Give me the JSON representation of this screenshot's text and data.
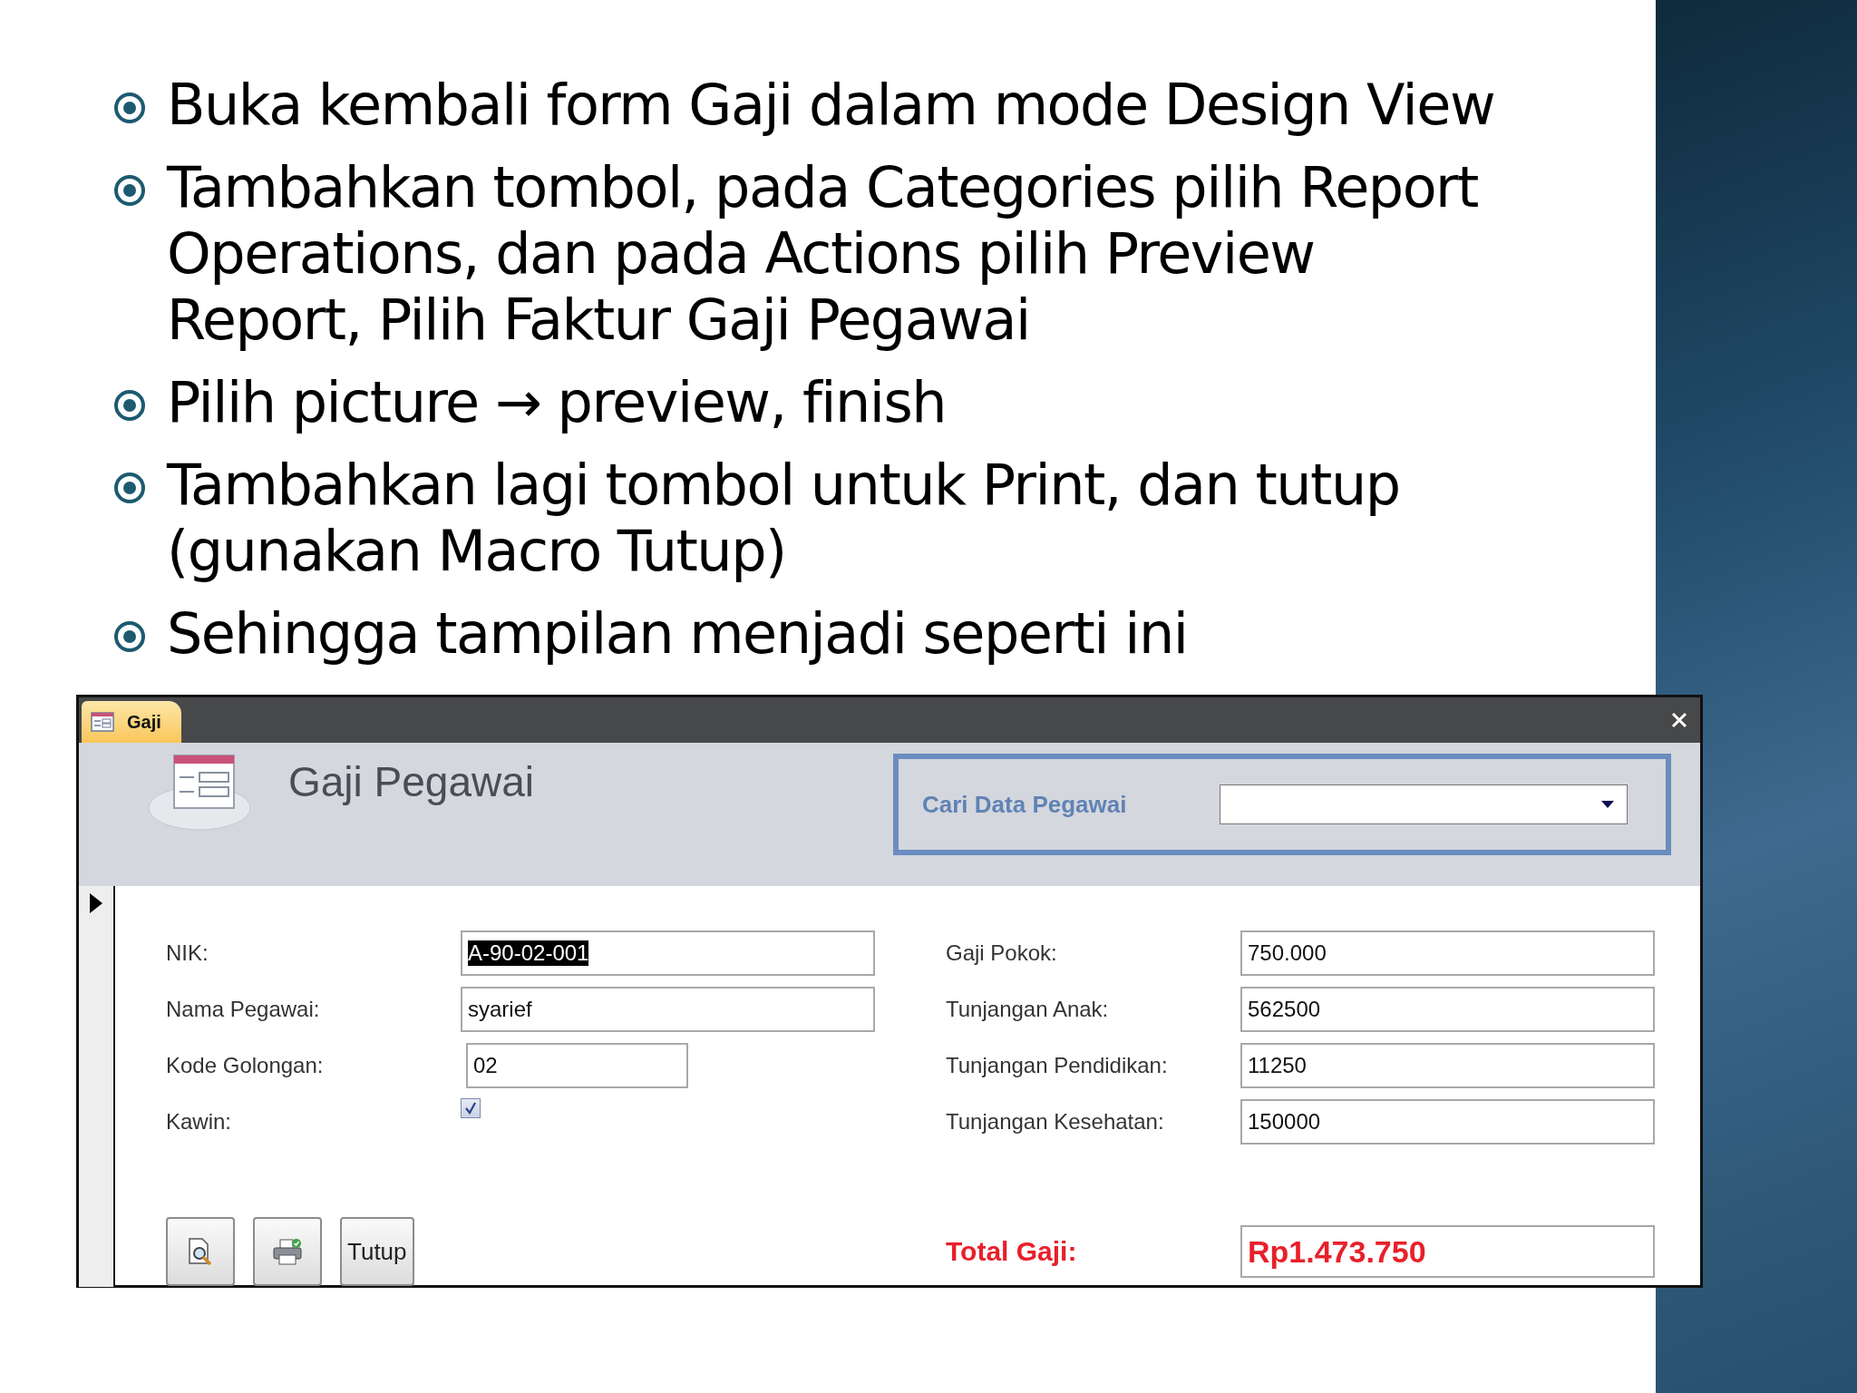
{
  "bullets": [
    {
      "text": "Buka kembali form Gaji dalam mode Design View"
    },
    {
      "text": "Tambahkan tombol, pada Categories pilih Report Operations, dan pada Actions pilih Preview Report, Pilih Faktur Gaji Pegawai"
    },
    {
      "text": "Pilih picture → preview, finish"
    },
    {
      "text": "Tambahkan lagi tombol untuk Print, dan tutup (gunakan Macro Tutup)"
    },
    {
      "text": "Sehingga tampilan menjadi seperti ini"
    }
  ],
  "form_window": {
    "tab": {
      "label": "Gaji"
    },
    "header": {
      "title": "Gaji Pegawai",
      "search": {
        "label": "Cari Data Pegawai"
      }
    },
    "left_fields": [
      {
        "label": "NIK:",
        "kind": "text",
        "value": "A-90-02-001",
        "highlighted": true
      },
      {
        "label": "Nama Pegawai:",
        "kind": "text",
        "value": "syarief",
        "highlighted": false
      },
      {
        "label": "Kode Golongan:",
        "kind": "short",
        "value": "02",
        "highlighted": false
      },
      {
        "label": "Kawin:",
        "kind": "checkbox",
        "checked": true
      }
    ],
    "right_fields": [
      {
        "label": "Gaji Pokok:",
        "value": "750.000"
      },
      {
        "label": "Tunjangan Anak:",
        "value": "562500"
      },
      {
        "label": "Tunjangan Pendidikan:",
        "value": "11250"
      },
      {
        "label": "Tunjangan Kesehatan:",
        "value": "150000"
      }
    ],
    "total": {
      "label": "Total Gaji:",
      "value": "Rp1.473.750"
    },
    "buttons": [
      {
        "kind": "preview"
      },
      {
        "kind": "print"
      },
      {
        "kind": "text",
        "label": "Tutup"
      }
    ]
  }
}
